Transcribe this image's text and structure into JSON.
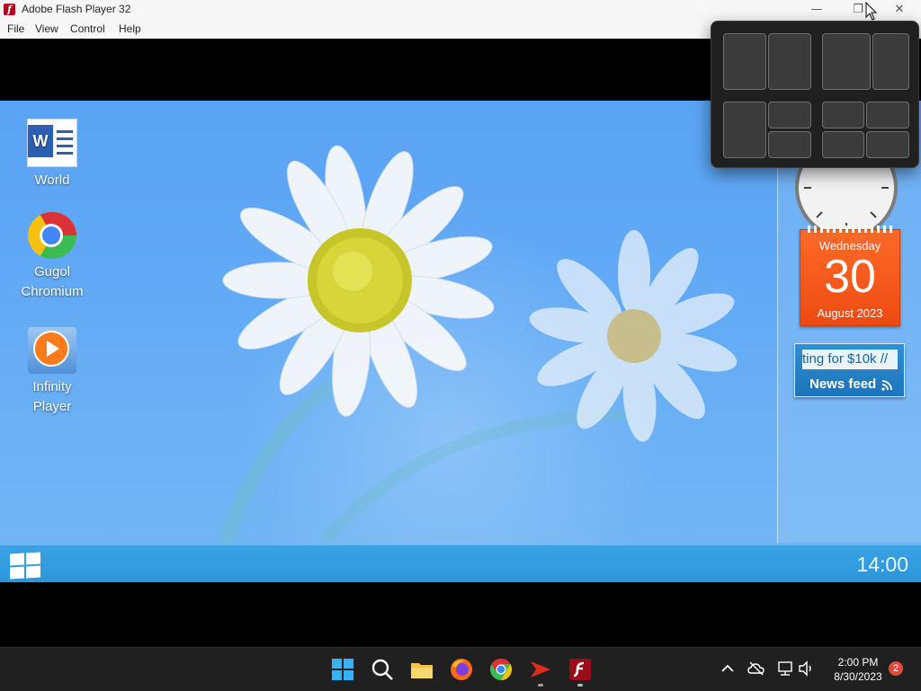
{
  "window": {
    "title": "Adobe Flash Player 32",
    "controls": {
      "minimize": "—",
      "maximize": "❐",
      "close": "✕"
    }
  },
  "menu": {
    "items": [
      {
        "label": "File"
      },
      {
        "label": "View"
      },
      {
        "label": "Control"
      },
      {
        "label": "Help"
      }
    ]
  },
  "desktop": {
    "icons": [
      {
        "label": "World"
      },
      {
        "label": "Gugol Chromium"
      },
      {
        "label": "Infinity Player"
      }
    ],
    "word_letter": "W"
  },
  "gadgets": {
    "calendar": {
      "weekday": "Wednesday",
      "day": "30",
      "month": "August 2023"
    },
    "news": {
      "ticker": "ting for $10k //",
      "label": "News feed"
    }
  },
  "inner_taskbar": {
    "time": "14:00"
  },
  "taskbar": {
    "time": "2:00 PM",
    "date": "8/30/2023",
    "notifications": "2"
  },
  "colors": {
    "sky": "#5aa3f4",
    "calendar": "#ff5a1f",
    "news": "#2f8fd4",
    "inner_taskbar": "#2b96da",
    "taskbar": "#202020"
  }
}
